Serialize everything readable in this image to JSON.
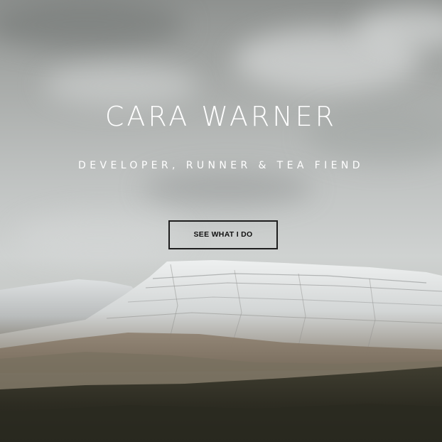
{
  "hero": {
    "title": "CARA WARNER",
    "subtitle": "DEVELOPER, RUNNER & TEA FIEND",
    "cta_label": "SEE WHAT I DO"
  },
  "colors": {
    "text": "#ffffff",
    "button_border": "#1e1e1e",
    "button_text": "#111111"
  }
}
